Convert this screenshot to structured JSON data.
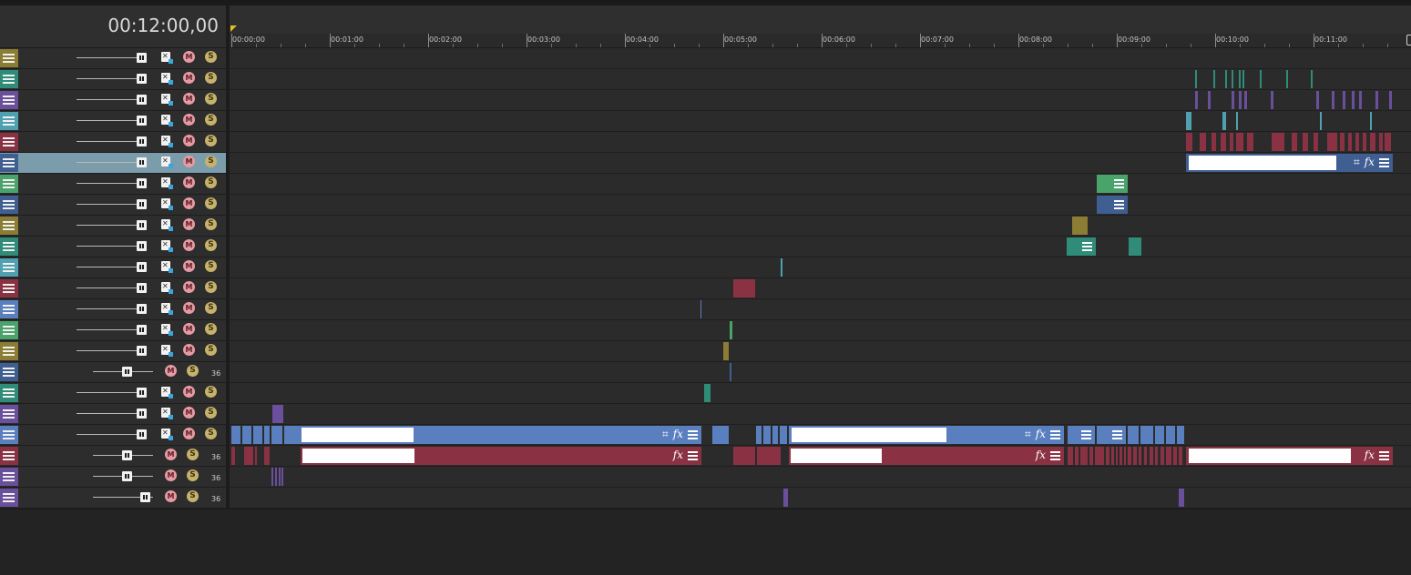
{
  "timecode": "00:12:00,00",
  "ruler": {
    "labels": [
      "00:00:00",
      "00:01:00",
      "00:02:00",
      "00:03:00",
      "00:04:00",
      "00:05:00",
      "00:06:00",
      "00:07:00",
      "00:08:00",
      "00:09:00",
      "00:10:00",
      "00:11:00"
    ]
  },
  "tracks": [
    {
      "color": "#8b7d33",
      "type": "video"
    },
    {
      "color": "#2e8c78",
      "type": "video"
    },
    {
      "color": "#6a4f9c",
      "type": "video"
    },
    {
      "color": "#4fa1b1",
      "type": "video"
    },
    {
      "color": "#8a3243",
      "type": "video"
    },
    {
      "color": "#3f5e92",
      "type": "video",
      "selected": true
    },
    {
      "color": "#4aa36a",
      "type": "video"
    },
    {
      "color": "#3f5e92",
      "type": "video"
    },
    {
      "color": "#8b7d33",
      "type": "video"
    },
    {
      "color": "#2e8c78",
      "type": "video"
    },
    {
      "color": "#4fa1b1",
      "type": "video"
    },
    {
      "color": "#8a3243",
      "type": "video"
    },
    {
      "color": "#5a7fbf",
      "type": "video"
    },
    {
      "color": "#4aa36a",
      "type": "video"
    },
    {
      "color": "#8b7d33",
      "type": "video"
    },
    {
      "color": "#3f5e92",
      "type": "audio",
      "label": "36"
    },
    {
      "color": "#2e8c78",
      "type": "video"
    },
    {
      "color": "#6a4f9c",
      "type": "video"
    },
    {
      "color": "#5a7fbf",
      "type": "video"
    },
    {
      "color": "#8a3243",
      "type": "audio",
      "label": "36"
    },
    {
      "color": "#6a4f9c",
      "type": "audio",
      "label": "36"
    },
    {
      "color": "#6a4f9c",
      "type": "audio",
      "label": "36"
    }
  ],
  "icons": {
    "mute": "M",
    "solo": "S",
    "crop": "⌗",
    "fx": "fx"
  }
}
